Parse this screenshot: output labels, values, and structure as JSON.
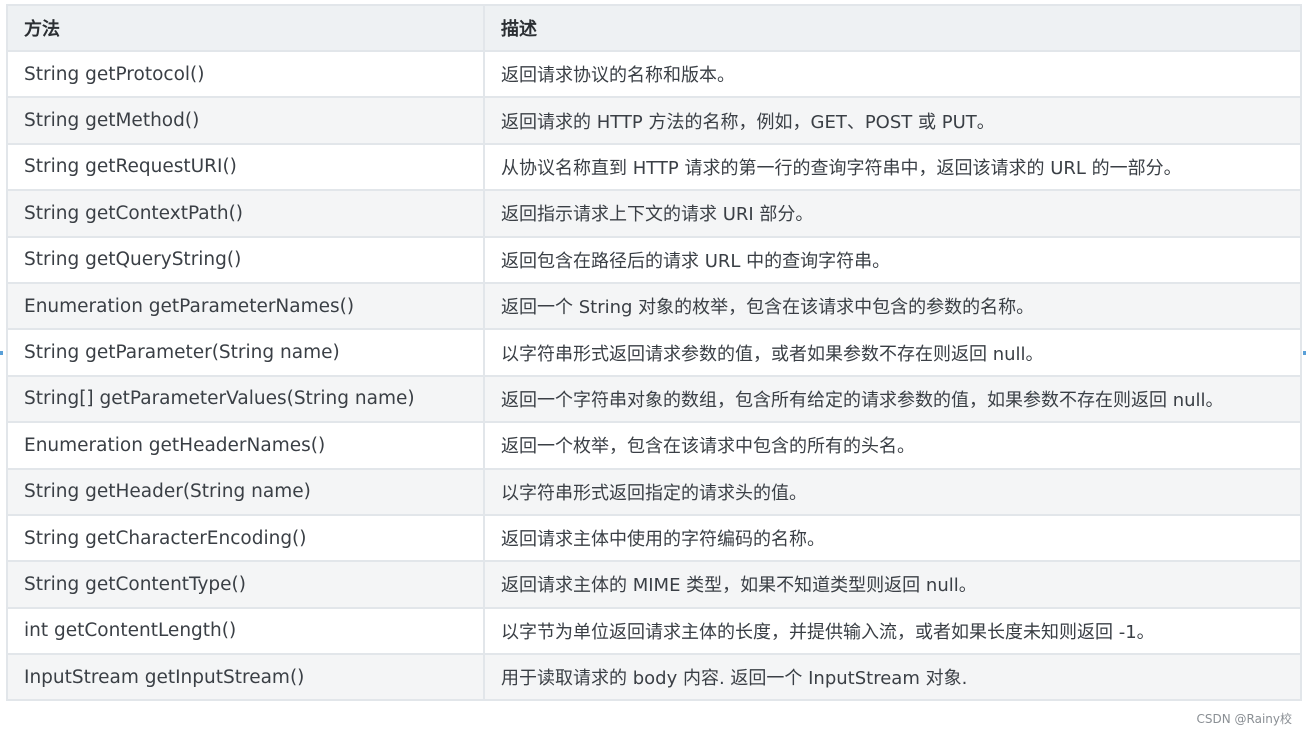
{
  "table": {
    "headers": [
      "方法",
      "描述"
    ],
    "rows": [
      [
        "String getProtocol()",
        "返回请求协议的名称和版本。"
      ],
      [
        "String getMethod()",
        "返回请求的 HTTP 方法的名称，例如，GET、POST 或 PUT。"
      ],
      [
        "String getRequestURI()",
        "从协议名称直到 HTTP 请求的第一行的查询字符串中，返回该请求的 URL 的一部分。"
      ],
      [
        "String getContextPath()",
        "返回指示请求上下文的请求 URI 部分。"
      ],
      [
        "String getQueryString()",
        "返回包含在路径后的请求 URL 中的查询字符串。"
      ],
      [
        "Enumeration getParameterNames()",
        "返回一个 String 对象的枚举，包含在该请求中包含的参数的名称。"
      ],
      [
        "String getParameter(String name)",
        "以字符串形式返回请求参数的值，或者如果参数不存在则返回 null。"
      ],
      [
        "String[] getParameterValues(String name)",
        "返回一个字符串对象的数组，包含所有给定的请求参数的值，如果参数不存在则返回 null。"
      ],
      [
        "Enumeration getHeaderNames()",
        "返回一个枚举，包含在该请求中包含的所有的头名。"
      ],
      [
        "String getHeader(String name)",
        "以字符串形式返回指定的请求头的值。"
      ],
      [
        "String getCharacterEncoding()",
        "返回请求主体中使用的字符编码的名称。"
      ],
      [
        "String getContentType()",
        "返回请求主体的 MIME 类型，如果不知道类型则返回 null。"
      ],
      [
        "int getContentLength()",
        "以字节为单位返回请求主体的长度，并提供输入流，或者如果长度未知则返回 -1。"
      ],
      [
        "InputStream getInputStream()",
        "用于读取请求的 body 内容. 返回一个 InputStream 对象."
      ]
    ]
  },
  "watermark": "CSDN @Rainy校"
}
